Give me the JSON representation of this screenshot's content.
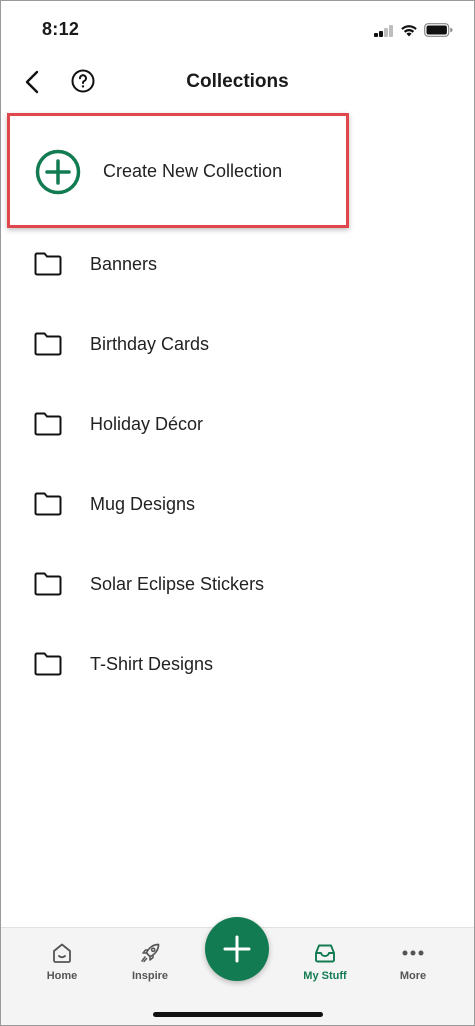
{
  "status_bar": {
    "time": "8:12"
  },
  "header": {
    "title": "Collections",
    "back_icon": "chevron-left-icon",
    "help_icon": "question-circle-icon"
  },
  "create": {
    "label": "Create New Collection",
    "icon": "plus-circle-icon",
    "highlight_color": "#e0474c"
  },
  "collections": [
    {
      "name": "Banners"
    },
    {
      "name": "Birthday Cards"
    },
    {
      "name": "Holiday Décor"
    },
    {
      "name": "Mug Designs"
    },
    {
      "name": "Solar Eclipse Stickers"
    },
    {
      "name": "T-Shirt Designs"
    }
  ],
  "tab_bar": {
    "tabs": [
      {
        "label": "Home",
        "icon": "home-icon",
        "active": false
      },
      {
        "label": "Inspire",
        "icon": "rocket-icon",
        "active": false
      },
      {
        "label": "My Stuff",
        "icon": "inbox-tray-icon",
        "active": true
      },
      {
        "label": "More",
        "icon": "more-dots-icon",
        "active": false
      }
    ],
    "fab_icon": "plus-icon"
  },
  "colors": {
    "accent": "#127b52",
    "highlight": "#e0474c"
  }
}
